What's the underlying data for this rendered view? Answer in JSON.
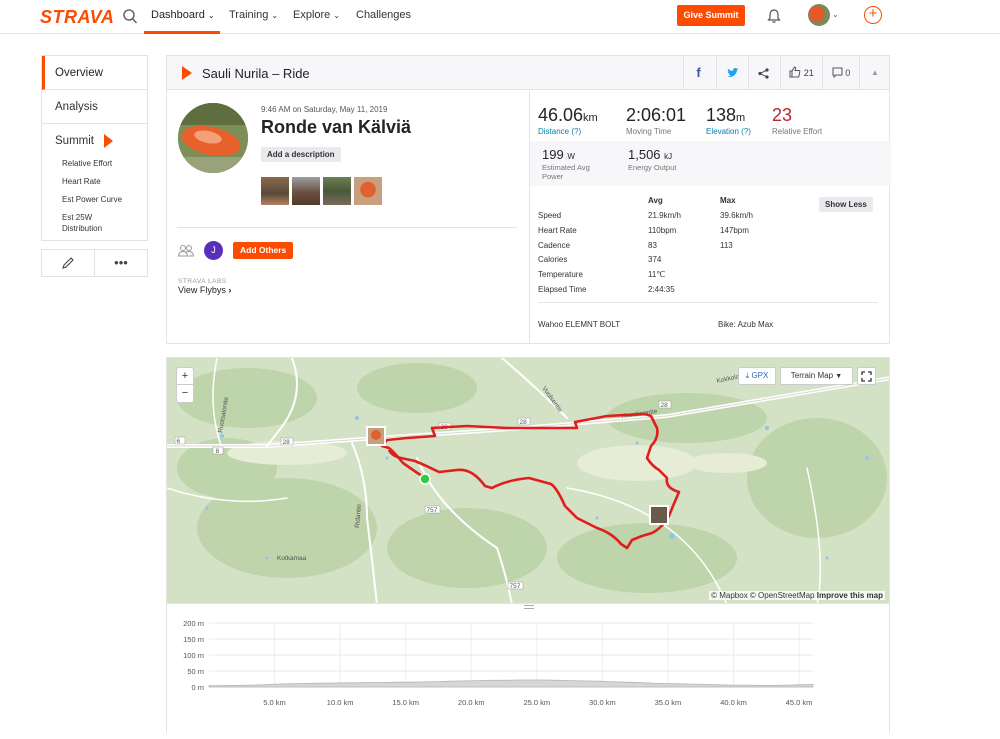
{
  "topbar": {
    "logo": "STRAVA",
    "nav": [
      "Dashboard",
      "Training",
      "Explore",
      "Challenges"
    ],
    "give_summit": "Give Summit"
  },
  "sidenav": {
    "overview": "Overview",
    "analysis": "Analysis",
    "summit": "Summit",
    "sub": [
      "Relative Effort",
      "Heart Rate",
      "Est Power Curve",
      "Est 25W Distribution"
    ],
    "more": "•••"
  },
  "activity": {
    "header_title": "Sauli Nurila – Ride",
    "kudos": "21",
    "comments": "0",
    "date": "9:46 AM on Saturday, May 11, 2019",
    "name": "Ronde van Kälviä",
    "add_description": "Add a description",
    "avatar_letter": "J",
    "add_others": "Add Others",
    "labs": "STRAVA LABS",
    "flybys": "View Flybys"
  },
  "stats": {
    "distance": {
      "value": "46.06",
      "unit": "km",
      "label": "Distance (?)"
    },
    "moving_time": {
      "value": "2:06:01",
      "label": "Moving Time"
    },
    "elevation": {
      "value": "138",
      "unit": "m",
      "label": "Elevation (?)"
    },
    "relative_effort": {
      "value": "23",
      "label": "Relative Effort"
    },
    "power": {
      "value": "199",
      "unit": "W",
      "label": "Estimated Avg Power"
    },
    "energy": {
      "value": "1,506",
      "unit": "kJ",
      "label": "Energy Output"
    }
  },
  "table": {
    "headers": {
      "avg": "Avg",
      "max": "Max"
    },
    "show_less": "Show Less",
    "rows": [
      {
        "label": "Speed",
        "avg": "21.9km/h",
        "max": "39.6km/h"
      },
      {
        "label": "Heart Rate",
        "avg": "110bpm",
        "max": "147bpm"
      },
      {
        "label": "Cadence",
        "avg": "83",
        "max": "113"
      },
      {
        "label": "Calories",
        "avg": "374",
        "max": ""
      },
      {
        "label": "Temperature",
        "avg": "11℃",
        "max": ""
      },
      {
        "label": "Elapsed Time",
        "avg": "2:44:35",
        "max": ""
      }
    ],
    "device": "Wahoo ELEMNT BOLT",
    "bike": "Bike: Azub Max"
  },
  "map": {
    "gpx": "GPX",
    "terrain": "Terrain Map",
    "labels": [
      "Kokkolantie",
      "Vuolsentie",
      "Kaustinentie",
      "Ruotsalontie",
      "Ridantie",
      "Kotkamaa"
    ],
    "roads": [
      "28",
      "28",
      "28",
      "6",
      "8",
      "757",
      "757"
    ],
    "attribution_pre": "© Mapbox © OpenStreetMap",
    "attribution_link": "Improve this map"
  },
  "elevation_chart": {
    "y_ticks": [
      "200 m",
      "150 m",
      "100 m",
      "50 m",
      "0 m"
    ],
    "x_ticks": [
      "5.0 km",
      "10.0 km",
      "15.0 km",
      "20.0 km",
      "25.0 km",
      "30.0 km",
      "35.0 km",
      "40.0 km",
      "45.0 km"
    ]
  }
}
